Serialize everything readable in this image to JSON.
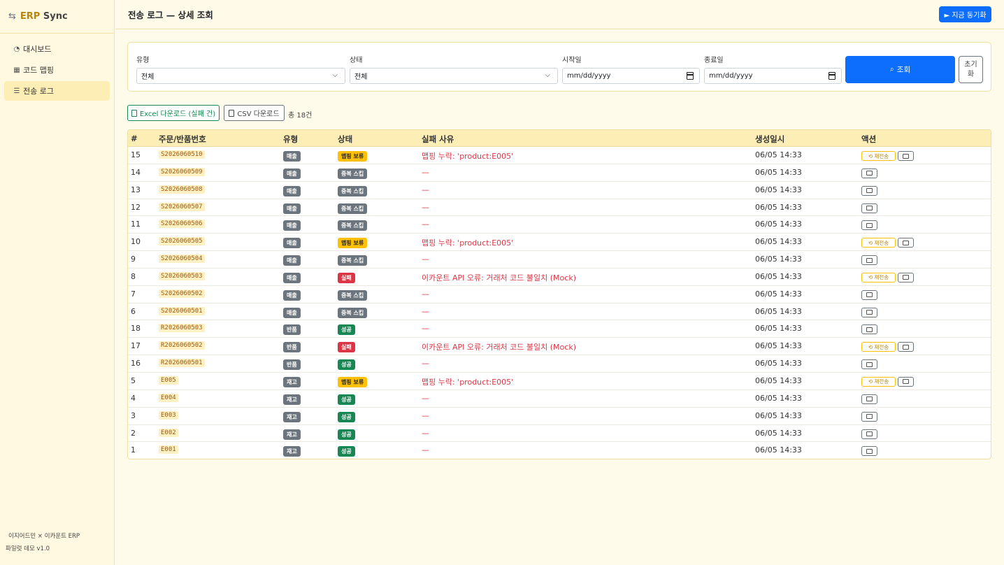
{
  "sidebar": {
    "brand_icon": "⇆",
    "brand_prefix": "ERP",
    "brand_suffix": " Sync",
    "items": [
      {
        "label": "대시보드",
        "icon": "speedometer-icon"
      },
      {
        "label": "코드 맵핑",
        "icon": "table-icon"
      },
      {
        "label": "전송 로그",
        "icon": "list-icon"
      }
    ],
    "footer_line1": "이지어드민 × 이카운트 ERP",
    "footer_line2": "파일럿 데모 v1.0"
  },
  "header": {
    "title": "전송 로그 — 상세 조회",
    "sync_button": "► 지금 동기화"
  },
  "filter": {
    "type_label": "유형",
    "type_value": "전체",
    "status_label": "상태",
    "status_value": "전체",
    "start_label": "시작일",
    "start_placeholder": "mm/dd/yyyy",
    "end_label": "종료일",
    "end_placeholder": "mm/dd/yyyy",
    "search_button": "조회",
    "reset_button": "초기\n화"
  },
  "toolbar": {
    "excel_button": "Excel 다운로드 (실패 건)",
    "csv_button": "CSV 다운로드",
    "count_text": "총 18건"
  },
  "table": {
    "headers": [
      "#",
      "주문/반품번호",
      "유형",
      "상태",
      "실패 사유",
      "생성일시",
      "액션"
    ],
    "retry_label": "⟲ 재전송",
    "rows": [
      {
        "num": "15",
        "order": "S2026060510",
        "type": "매출",
        "status": "맵핑 보류",
        "status_kind": "warn",
        "reason": "맵핑 누락: 'product:E005'",
        "date": "06/05 14:33",
        "retry": true
      },
      {
        "num": "14",
        "order": "S2026060509",
        "type": "매출",
        "status": "중복 스킵",
        "status_kind": "gray",
        "reason": "—",
        "date": "06/05 14:33",
        "retry": false
      },
      {
        "num": "13",
        "order": "S2026060508",
        "type": "매출",
        "status": "중복 스킵",
        "status_kind": "gray",
        "reason": "—",
        "date": "06/05 14:33",
        "retry": false
      },
      {
        "num": "12",
        "order": "S2026060507",
        "type": "매출",
        "status": "중복 스킵",
        "status_kind": "gray",
        "reason": "—",
        "date": "06/05 14:33",
        "retry": false
      },
      {
        "num": "11",
        "order": "S2026060506",
        "type": "매출",
        "status": "중복 스킵",
        "status_kind": "gray",
        "reason": "—",
        "date": "06/05 14:33",
        "retry": false
      },
      {
        "num": "10",
        "order": "S2026060505",
        "type": "매출",
        "status": "맵핑 보류",
        "status_kind": "warn",
        "reason": "맵핑 누락: 'product:E005'",
        "date": "06/05 14:33",
        "retry": true
      },
      {
        "num": "9",
        "order": "S2026060504",
        "type": "매출",
        "status": "중복 스킵",
        "status_kind": "gray",
        "reason": "—",
        "date": "06/05 14:33",
        "retry": false
      },
      {
        "num": "8",
        "order": "S2026060503",
        "type": "매출",
        "status": "실패",
        "status_kind": "red",
        "reason": "이카운트 API 오류: 거래처 코드 불일치 (Mock)",
        "date": "06/05 14:33",
        "retry": true
      },
      {
        "num": "7",
        "order": "S2026060502",
        "type": "매출",
        "status": "중복 스킵",
        "status_kind": "gray",
        "reason": "—",
        "date": "06/05 14:33",
        "retry": false
      },
      {
        "num": "6",
        "order": "S2026060501",
        "type": "매출",
        "status": "중복 스킵",
        "status_kind": "gray",
        "reason": "—",
        "date": "06/05 14:33",
        "retry": false
      },
      {
        "num": "18",
        "order": "R2026060503",
        "type": "반품",
        "status": "성공",
        "status_kind": "green",
        "reason": "—",
        "date": "06/05 14:33",
        "retry": false
      },
      {
        "num": "17",
        "order": "R2026060502",
        "type": "반품",
        "status": "실패",
        "status_kind": "red",
        "reason": "이카운트 API 오류: 거래처 코드 불일치 (Mock)",
        "date": "06/05 14:33",
        "retry": true
      },
      {
        "num": "16",
        "order": "R2026060501",
        "type": "반품",
        "status": "성공",
        "status_kind": "green",
        "reason": "—",
        "date": "06/05 14:33",
        "retry": false
      },
      {
        "num": "5",
        "order": "E005",
        "type": "재고",
        "status": "맵핑 보류",
        "status_kind": "warn",
        "reason": "맵핑 누락: 'product:E005'",
        "date": "06/05 14:33",
        "retry": true
      },
      {
        "num": "4",
        "order": "E004",
        "type": "재고",
        "status": "성공",
        "status_kind": "green",
        "reason": "—",
        "date": "06/05 14:33",
        "retry": false
      },
      {
        "num": "3",
        "order": "E003",
        "type": "재고",
        "status": "성공",
        "status_kind": "green",
        "reason": "—",
        "date": "06/05 14:33",
        "retry": false
      },
      {
        "num": "2",
        "order": "E002",
        "type": "재고",
        "status": "성공",
        "status_kind": "green",
        "reason": "—",
        "date": "06/05 14:33",
        "retry": false
      },
      {
        "num": "1",
        "order": "E001",
        "type": "재고",
        "status": "성공",
        "status_kind": "green",
        "reason": "—",
        "date": "06/05 14:33",
        "retry": false
      }
    ]
  },
  "colors": {
    "primary": "#0d6efd",
    "warning": "#ffc107",
    "danger": "#dc3545",
    "success": "#198754",
    "secondary": "#6c757d",
    "accent_bg": "#fdeeb5"
  }
}
